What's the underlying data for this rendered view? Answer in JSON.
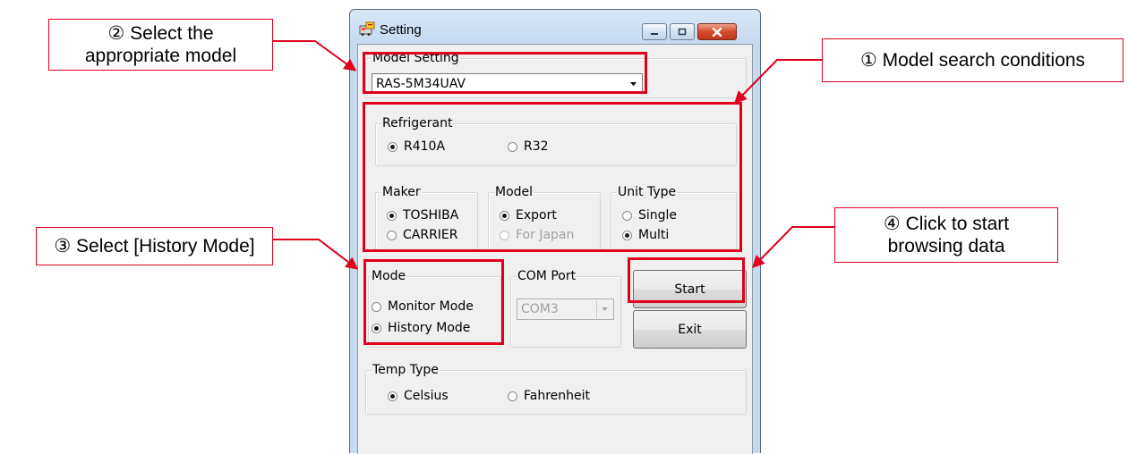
{
  "window": {
    "title": "Setting",
    "icon": "setting-app-icon",
    "caption_buttons": [
      "minimize-icon",
      "maximize-icon",
      "close-icon"
    ]
  },
  "model_setting": {
    "label": "Model Setting",
    "selected": "RAS-5M34UAV"
  },
  "refrigerant": {
    "label": "Refrigerant",
    "options": [
      "R410A",
      "R32"
    ],
    "selected": "R410A"
  },
  "maker": {
    "label": "Maker",
    "options": [
      "TOSHIBA",
      "CARRIER"
    ],
    "selected": "TOSHIBA"
  },
  "model": {
    "label": "Model",
    "options": [
      "Export",
      "For Japan"
    ],
    "selected": "Export",
    "disabled": [
      "For Japan"
    ]
  },
  "unit_type": {
    "label": "Unit Type",
    "options": [
      "Single",
      "Multi"
    ],
    "selected": "Multi"
  },
  "mode": {
    "label": "Mode",
    "options": [
      "Monitor Mode",
      "History Mode"
    ],
    "selected": "History Mode"
  },
  "com_port": {
    "label": "COM Port",
    "selected": "COM3",
    "disabled": true
  },
  "buttons": {
    "start": "Start",
    "exit": "Exit"
  },
  "temp_type": {
    "label": "Temp Type",
    "options": [
      "Celsius",
      "Fahrenheit"
    ],
    "selected": "Celsius"
  },
  "annotations": {
    "callout_1": "① Model search conditions",
    "callout_2_line1": "② Select the",
    "callout_2_line2": "appropriate model",
    "callout_3": "③ Select [History Mode]",
    "callout_4_line1": "④ Click to start",
    "callout_4_line2": "browsing data"
  },
  "colors": {
    "annotation_red": "#e0001b",
    "window_frame": "#c5d9ef",
    "dialog_bg": "#f0f0f0"
  }
}
